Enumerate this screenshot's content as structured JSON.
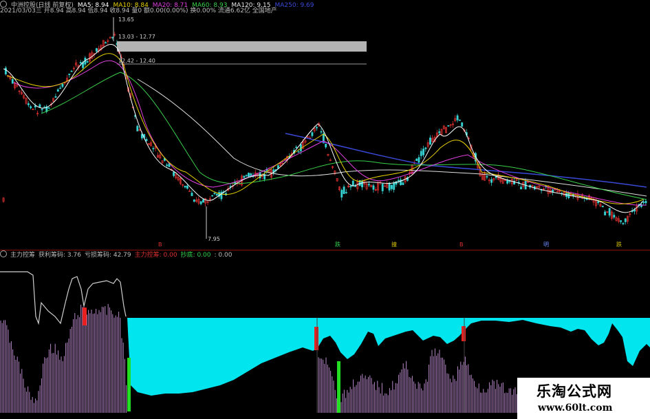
{
  "header": {
    "icon": "circle-icon",
    "title": "中洲控股(日线 前复权)",
    "ma5": "MA5: 8.94",
    "ma10": "MA10: 8.84",
    "ma20": "MA20: 8.71",
    "ma60": "MA60: 8.93",
    "ma120": "MA120: 9.15",
    "ma250": "MA250: 9.69",
    "quote": "2021/03/03三 开8.94 高8.94 低8.94 收8.94 量0 额0.00(0.00%) 换0.00% 流通6.62亿 全国地产"
  },
  "price_labels": {
    "high": "13.65",
    "band1": "13.03 - 12.77",
    "band2": "12.42 - 12.40",
    "low": "7.95"
  },
  "signal_marks": [
    "B",
    "跌",
    "撞",
    "B",
    "明",
    "跌"
  ],
  "indicator": {
    "icon": "circle-icon",
    "name": "主力控筹",
    "profit": "获利筹码: 3.76",
    "trapped": "亏损筹码: 42.79",
    "control": "主力控筹: 0.00",
    "bottom": "抄底: 0.00",
    "extra": ": 0.00"
  },
  "watermark": {
    "title": "乐淘公式网",
    "url": "www.60lt.com"
  },
  "colors": {
    "up": "#e03030",
    "down": "#35d0d0",
    "cyan_area": "#00e5ee",
    "bars": "#b888c8",
    "ma5": "#ffffff",
    "ma10": "#e6d200",
    "ma20": "#e040e0",
    "ma60": "#39d04a",
    "ma120": "#e8e8e8",
    "ma250": "#3a4ad8"
  }
}
